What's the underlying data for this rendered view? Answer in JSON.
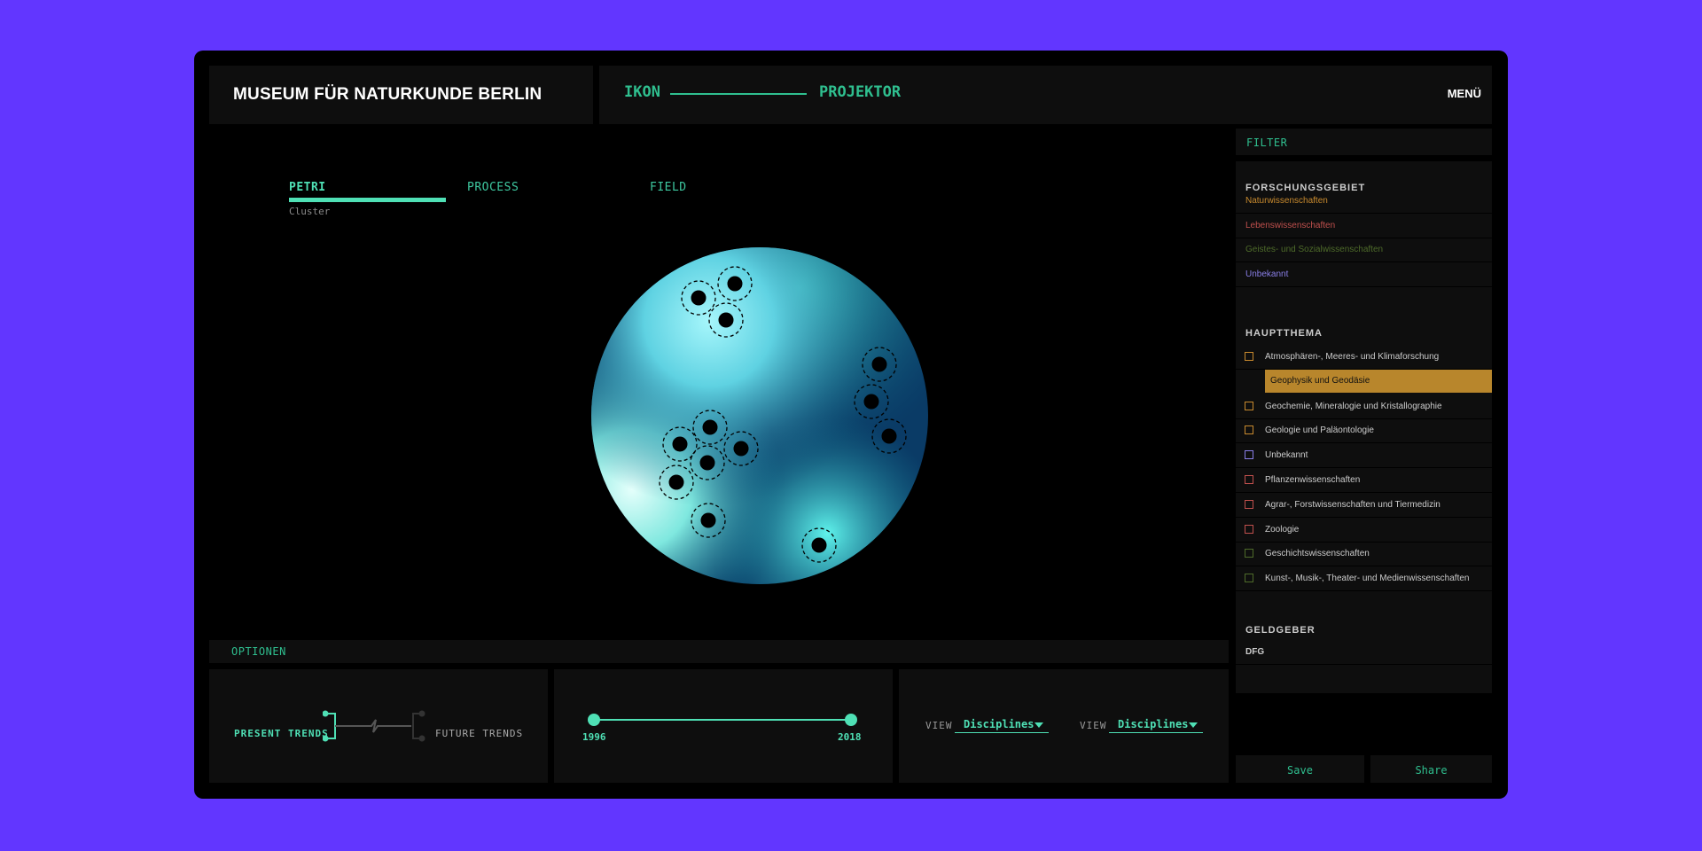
{
  "header": {
    "title": "MUSEUM FÜR NATURKUNDE BERLIN",
    "logo_left": "IKON",
    "logo_right": "PROJEKTOR",
    "menu_label": "MENÜ"
  },
  "tabs": [
    {
      "label": "PETRI",
      "active": true
    },
    {
      "label": "PROCESS",
      "active": false
    },
    {
      "label": "FIELD",
      "active": false
    }
  ],
  "tab_sub": "Cluster",
  "options": {
    "label": "OPTIONEN",
    "trend_left": "PRESENT TRENDS",
    "trend_right": "FUTURE TRENDS",
    "range_start": "1996",
    "range_end": "2018",
    "view_label": "VIEW",
    "view_1": "Disciplines",
    "view_2": "Disciplines"
  },
  "sidebar": {
    "filter_label": "FILTER",
    "forschung_label": "FORSCHUNGSGEBIET",
    "forschung_items": [
      {
        "label": "Naturwissenschaften",
        "color": "#c88a2e"
      },
      {
        "label": "Lebenswissenschaften",
        "color": "#c0504d"
      },
      {
        "label": "Geistes- und Sozialwissenschaften",
        "color": "#4e6b2a"
      },
      {
        "label": "Unbekannt",
        "color": "#8a7fe8"
      }
    ],
    "hauptthema_label": "HAUPTTHEMA",
    "hauptthema_items": [
      {
        "label": "Atmosphären-, Meeres- und Klimaforschung",
        "color": "#c88a2e"
      },
      {
        "label": "Geophysik und Geodäsie",
        "color": "#b8862c",
        "selected": true
      },
      {
        "label": "Geochemie, Mineralogie und Kristallographie",
        "color": "#c88a2e"
      },
      {
        "label": "Geologie und Paläontologie",
        "color": "#c88a2e"
      },
      {
        "label": "Unbekannt",
        "color": "#8a7fe8"
      },
      {
        "label": "Pflanzenwissenschaften",
        "color": "#c0504d"
      },
      {
        "label": "Agrar-, Forstwissenschaften und Tiermedizin",
        "color": "#c0504d"
      },
      {
        "label": "Zoologie",
        "color": "#c0504d"
      },
      {
        "label": "Geschichtswissenschaften",
        "color": "#4e6b2a"
      },
      {
        "label": "Kunst-, Musik-, Theater- und Medienwissenschaften",
        "color": "#4e6b2a"
      }
    ],
    "geldgeber_label": "GELDGEBER",
    "geldgeber_items": [
      "DFG"
    ],
    "save_label": "Save",
    "share_label": "Share"
  },
  "colors": {
    "accent": "#4fe0b5",
    "background": "#6236ff"
  }
}
